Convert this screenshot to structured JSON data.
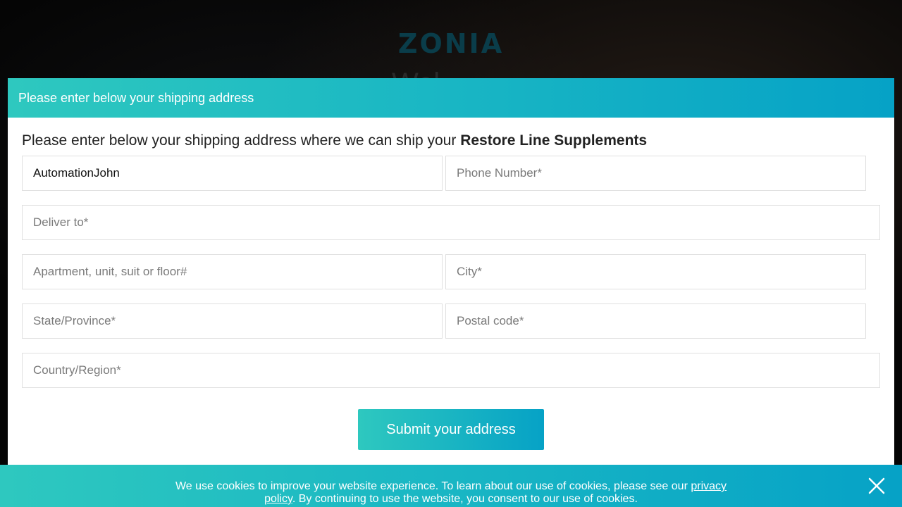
{
  "background": {
    "logo": "ZONIA",
    "heading": "Wel"
  },
  "modal": {
    "header_title": "Please enter below your shipping address",
    "intro_text": "Please enter below your shipping address where we can ship your ",
    "intro_product": "Restore Line Supplements",
    "fields": {
      "name": {
        "value": "AutomationJohn"
      },
      "phone": {
        "placeholder": "Phone Number*"
      },
      "deliver_to": {
        "placeholder": "Deliver to*"
      },
      "apartment": {
        "placeholder": "Apartment, unit, suit or floor#"
      },
      "city": {
        "placeholder": "City*"
      },
      "state": {
        "placeholder": "State/Province*"
      },
      "postal": {
        "placeholder": "Postal code*"
      },
      "country": {
        "placeholder": "Country/Region*"
      }
    },
    "submit_label": "Submit your address"
  },
  "cookie_bar": {
    "text_before": "We use cookies to improve your website experience. To learn about our use of cookies, please see our ",
    "link_label": "privacy policy",
    "text_after": ". By continuing to use the website, you consent to our use of cookies.",
    "close_icon": "close-icon"
  },
  "colors": {
    "accent_start": "#2ec8bf",
    "accent_end": "#06a2c6"
  }
}
